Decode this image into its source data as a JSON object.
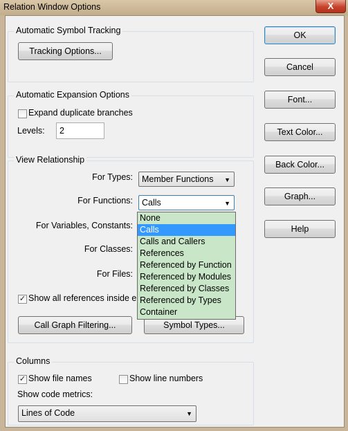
{
  "window": {
    "title": "Relation Window Options",
    "close_glyph": "X"
  },
  "groups": {
    "tracking": "Automatic Symbol Tracking",
    "expansion": "Automatic Expansion Options",
    "view": "View Relationship",
    "columns": "Columns"
  },
  "tracking_options_button": "Tracking Options...",
  "expand_duplicate": {
    "label": "Expand duplicate branches",
    "checked": false
  },
  "levels": {
    "label": "Levels:",
    "value": "2"
  },
  "for_types": {
    "label": "For Types:",
    "value": "Member Functions"
  },
  "for_functions": {
    "label": "For Functions:",
    "value": "Calls"
  },
  "for_variables": {
    "label": "For Variables, Constants:"
  },
  "for_classes": {
    "label": "For Classes:"
  },
  "for_files": {
    "label": "For Files:"
  },
  "show_all_refs": {
    "label": "Show all references inside e",
    "checked": true
  },
  "call_graph_button": "Call Graph Filtering...",
  "symbol_types_button": "Symbol Types...",
  "dropdown_options": [
    "None",
    "Calls",
    "Calls and Callers",
    "References",
    "Referenced by Function",
    "Referenced by Modules",
    "Referenced by Classes",
    "Referenced by Types",
    "Container"
  ],
  "dropdown_selected_index": 1,
  "show_file_names": {
    "label": "Show file names",
    "checked": true
  },
  "show_line_numbers": {
    "label": "Show line numbers",
    "checked": false
  },
  "code_metrics": {
    "label": "Show code metrics:",
    "value": "Lines of Code"
  },
  "side_buttons": {
    "ok": "OK",
    "cancel": "Cancel",
    "font": "Font...",
    "text_color": "Text Color...",
    "back_color": "Back Color...",
    "graph": "Graph...",
    "help": "Help"
  }
}
